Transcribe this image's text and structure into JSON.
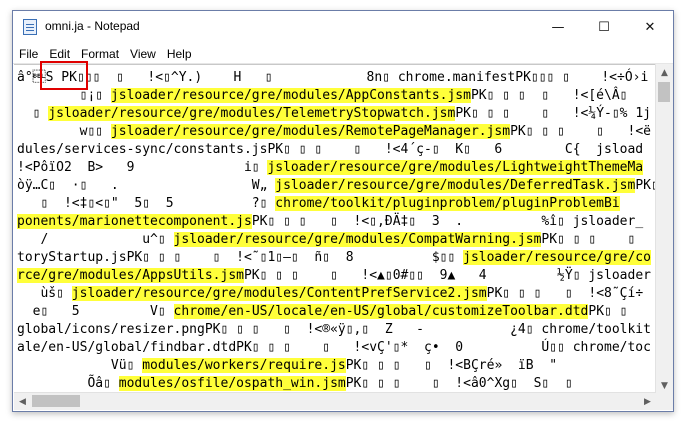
{
  "window": {
    "title": "omni.ja - Notepad",
    "controls": {
      "minimize": "—",
      "maximize": "☐",
      "close": "✕"
    }
  },
  "menu": [
    "File",
    "Edit",
    "Format",
    "View",
    "Help"
  ],
  "scroll": {
    "up": "▲",
    "down": "▼",
    "left": "◀",
    "right": "▶"
  },
  "lines": [
    [
      [
        "â°\u0007S PK▯▯▯  ▯   !<▯^Y.)    H   ▯            8n▯ chrome.manifestPK▯▯▯ ▯    !<÷Ó›i",
        false
      ]
    ],
    [
      [
        "        ▯¡▯ ",
        false
      ],
      [
        "jsloader/resource/gre/modules/AppConstants.jsm",
        true
      ],
      [
        "PK▯ ▯ ▯  ▯   !<[é\\Â▯",
        false
      ]
    ],
    [
      [
        "  ▯ ",
        false
      ],
      [
        "jsloader/resource/gre/modules/TelemetryStopwatch.jsm",
        true
      ],
      [
        "PK▯ ▯ ▯    ▯   !<¼Ý-▯% 1j",
        false
      ]
    ],
    [
      [
        "        w▯▯ ",
        false
      ],
      [
        "jsloader/resource/gre/modules/RemotePageManager.jsm",
        true
      ],
      [
        "PK▯ ▯ ▯    ▯   !<ë ùÏ",
        false
      ]
    ],
    [
      [
        "dules/services-sync/constants.jsPK▯ ▯ ▯    ▯   !<4´ç-▯  K▯   6        C{  jsload",
        false
      ]
    ],
    [
      [
        "!<PôïO2  B>   9              i▯ ",
        false
      ],
      [
        "jsloader/resource/gre/modules/LightweightThemeMa",
        true
      ]
    ],
    [
      [
        "òÿ…C▯  ·▯   .                 W„ ",
        false
      ],
      [
        "jsloader/resource/gre/modules/DeferredTask.jsm",
        true
      ],
      [
        "PK▯ ▯ ▯",
        false
      ]
    ],
    [
      [
        "   ▯  !<‡▯<▯\"  5▯  5          ?▯ ",
        false
      ],
      [
        "chrome/toolkit/pluginproblem/pluginProblemBi",
        true
      ]
    ],
    [
      [
        "",
        false
      ],
      [
        "ponents/marionettecomponent.js",
        true
      ],
      [
        "PK▯ ▯ ▯   ▯  !<▯,ÐÄ‡▯  3  .          %î▯ jsloader_",
        false
      ]
    ],
    [
      [
        "   /            u^▯ ",
        false
      ],
      [
        "jsloader/resource/gre/modules/CompatWarning.jsm",
        true
      ],
      [
        "PK▯ ▯ ▯    ▯   !<",
        false
      ]
    ],
    [
      [
        "toryStartup.jsPK▯ ▯ ▯    ▯  !<˜▯1▯–▯  ñ▯  8          $▯▯ ",
        false
      ],
      [
        "jsloader/resource/gre/co",
        true
      ]
    ],
    [
      [
        "",
        false
      ],
      [
        "rce/gre/modules/AppsUtils.jsm",
        true
      ],
      [
        "PK▯ ▯ ▯    ▯   !<▲▯0#▯▯  9▲   4         ½Ÿ▯ jsloader",
        false
      ]
    ],
    [
      [
        "   ùš▯ ",
        false
      ],
      [
        "jsloader/resource/gre/modules/ContentPrefService2.jsm",
        true
      ],
      [
        "PK▯ ▯ ▯   ▯  !<8˜Çí÷",
        false
      ]
    ],
    [
      [
        "  e▯   5         V▯ ",
        false
      ],
      [
        "chrome/en-US/locale/en-US/global/customizeToolbar.dtd",
        true
      ],
      [
        "PK▯ ▯",
        false
      ]
    ],
    [
      [
        "global/icons/resizer.pngPK▯ ▯ ▯   ▯  !<®«ÿ▯,▯  Z   -           ¿4▯ chrome/toolkit",
        false
      ]
    ],
    [
      [
        "ale/en-US/global/findbar.dtdPK▯ ▯ ▯    ▯   !<vÇ'▯*  ç•  0          Ú▯▯ chrome/toc",
        false
      ]
    ],
    [
      [
        "            Vü▯ ",
        false
      ],
      [
        "modules/workers/require.js",
        true
      ],
      [
        "PK▯ ▯ ▯   ▯  !<BÇré»  ïB  \"",
        false
      ]
    ],
    [
      [
        "         Õâ▯ ",
        false
      ],
      [
        "modules/osfile/ospath_win.jsm",
        true
      ],
      [
        "PK▯ ▯ ▯    ▯  !<â0^Xg▯  S▯  ▯",
        false
      ]
    ]
  ]
}
